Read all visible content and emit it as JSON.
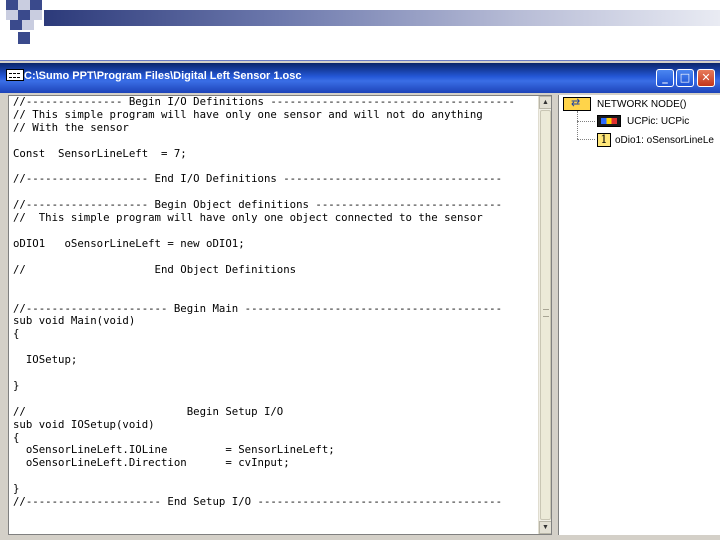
{
  "window": {
    "title": "C:\\Sumo PPT\\Program Files\\Digital Left Sensor 1.osc",
    "buttons": {
      "minimize": "_",
      "maximize": "□",
      "close": "✕"
    }
  },
  "editor": {
    "code": "//--------------- Begin I/O Definitions --------------------------------------\n// This simple program will have only one sensor and will not do anything\n// With the sensor\n\nConst  SensorLineLeft  = 7;\n\n//------------------- End I/O Definitions ----------------------------------\n\n//------------------- Begin Object definitions -----------------------------\n//  This simple program will have only one object connected to the sensor\n\noDIO1   oSensorLineLeft = new oDIO1;\n\n//                    End Object Definitions\n\n\n//---------------------- Begin Main ----------------------------------------\nsub void Main(void)\n{\n\n  IOSetup;\n\n}\n\n//                         Begin Setup I/O\nsub void IOSetup(void)\n{\n  oSensorLineLeft.IOLine         = SensorLineLeft;\n  oSensorLineLeft.Direction      = cvInput;\n\n}\n//--------------------- End Setup I/O --------------------------------------"
  },
  "tree": {
    "root": "NETWORK NODE()",
    "children": [
      {
        "label": "UCPic: UCPic",
        "icon": "ucp-board-icon"
      },
      {
        "label": "oDio1: oSensorLineLe",
        "icon": "dio-object-icon",
        "badge": "1"
      }
    ]
  },
  "colors": {
    "titlebar": "#0a246a",
    "window_face": "#d4d0c8",
    "slide_band": "#2c3a7a"
  }
}
